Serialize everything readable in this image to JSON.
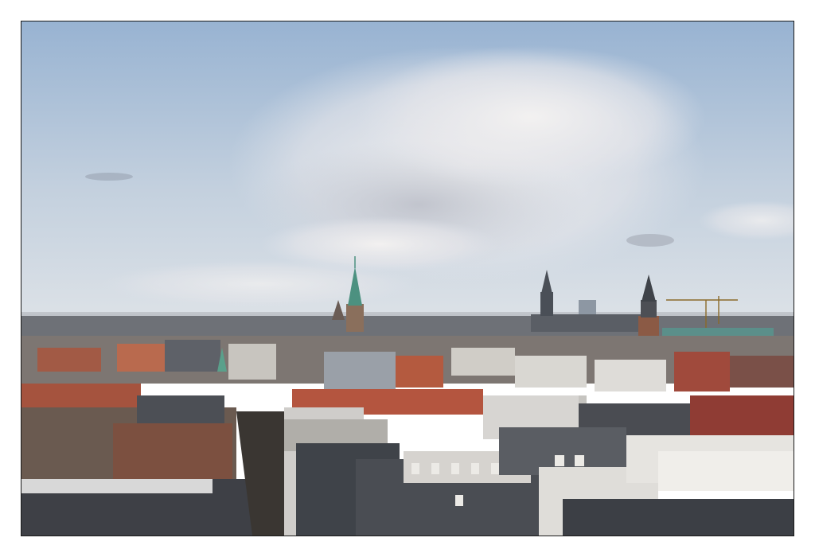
{
  "scene": {
    "kind": "photograph",
    "subject": "city-rooftops-skyline",
    "colors": {
      "sky_top": "#9fb9d6",
      "sky_bottom": "#d9e0e6",
      "cloud": "#eef0f2",
      "roof_red": "#a5533e",
      "roof_dark": "#3f4349",
      "wall_light": "#d8d6d2",
      "copper_green": "#4d9a86",
      "frame_border": "#1a1a1a"
    }
  }
}
